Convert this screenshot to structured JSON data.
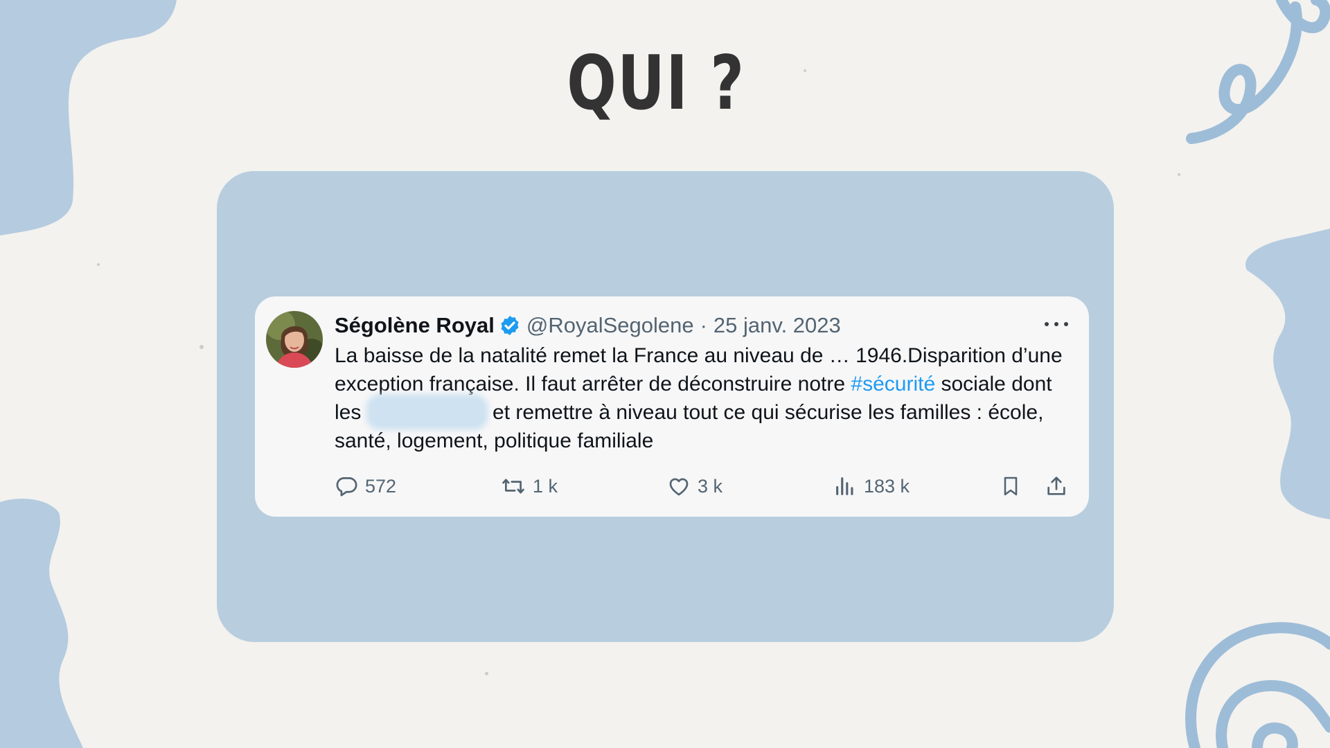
{
  "title": "QUI ?",
  "tweet": {
    "author_name": "Ségolène Royal",
    "handle": "@RoyalSegolene",
    "separator": "·",
    "date": "25 janv. 2023",
    "text_part1": "La baisse de la natalité remet la France au niveau de … 1946.Disparition d’une exception française. Il faut arrêter de déconstruire notre ",
    "hashtag": "#sécurité",
    "text_part2": " sociale dont les ",
    "text_part3": " et remettre à niveau tout ce qui sécurise les familles : école, santé, logement, politique familiale",
    "stats": {
      "replies": "572",
      "retweets": "1 k",
      "likes": "3 k",
      "views": "183 k"
    }
  },
  "colors": {
    "page_background": "#f3f2ef",
    "panel": "#b8cedf",
    "card": "#f7f7f8",
    "accent": "#1d9bf0",
    "decoration": "#a9c4dc"
  },
  "icons": [
    "verified-badge-icon",
    "more-options-icon",
    "reply-icon",
    "retweet-icon",
    "like-icon",
    "views-icon",
    "bookmark-icon",
    "share-icon"
  ]
}
